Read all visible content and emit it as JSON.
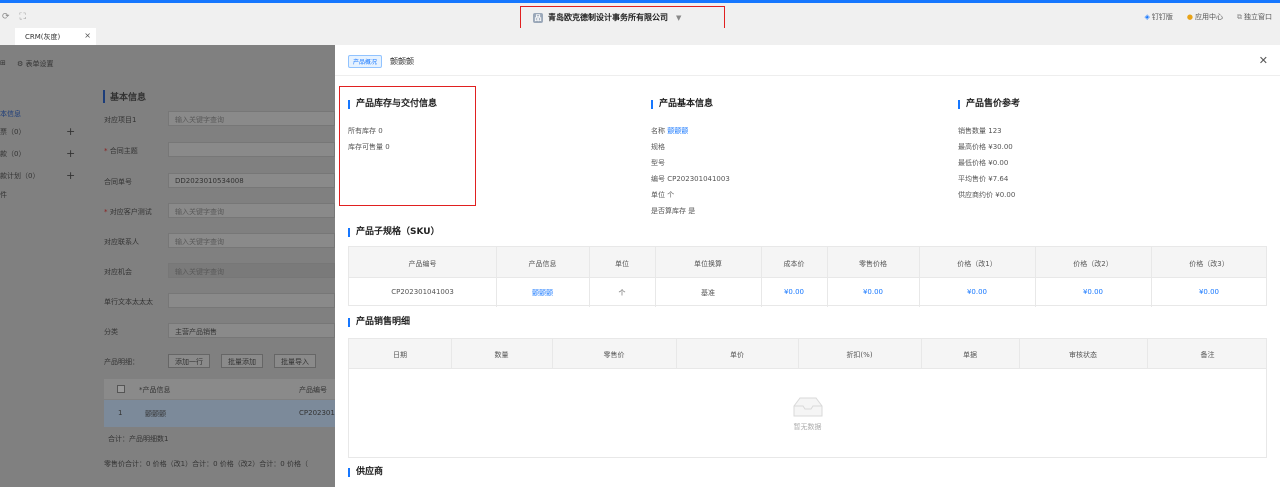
{
  "topbar": {
    "company": "青岛欧克德制设计事务所有限公司",
    "links": [
      "钉钉版",
      "应用中心",
      "独立窗口"
    ]
  },
  "tab": {
    "label": "CRM(灰度)",
    "close": "×"
  },
  "bg": {
    "toolbar_label": "表单设置",
    "side": [
      "本信息",
      "票（0）",
      "款（0）",
      "款计划（0）",
      "件"
    ],
    "section": "基本信息",
    "form_labels": [
      "对应项目1",
      "合同主题",
      "合同单号",
      "对应客户测试",
      "对应联系人",
      "对应机会",
      "单行文本太太太",
      "分类",
      "产品明细："
    ],
    "placeholder": "输入关键字查询",
    "contract_no": "DD2023010534008",
    "category": "主营产品销售",
    "btns": [
      "添加一行",
      "批量添加",
      "批量导入"
    ],
    "th": [
      "*产品信息",
      "产品编号"
    ],
    "row": {
      "idx": "1",
      "name": "颤颤颤",
      "code": "CP2023010"
    },
    "total": "合计：产品明细数1",
    "footer": "零售价合计：0 价格（改1）合计：0 价格（改2）合计：0 价格（"
  },
  "panel": {
    "badge": "产品概况",
    "title": "颤颤颤",
    "stock": {
      "title": "产品库存与交付信息",
      "items": [
        {
          "k": "所有库存",
          "v": "0"
        },
        {
          "k": "库存可售量",
          "v": "0"
        }
      ]
    },
    "basic": {
      "title": "产品基本信息",
      "items": [
        {
          "k": "名称",
          "v": "颤颤颤"
        },
        {
          "k": "规格",
          "v": ""
        },
        {
          "k": "型号",
          "v": ""
        },
        {
          "k": "编号",
          "v": "CP202301041003"
        },
        {
          "k": "单位",
          "v": "个"
        },
        {
          "k": "是否算库存",
          "v": "是"
        }
      ]
    },
    "price": {
      "title": "产品售价参考",
      "items": [
        {
          "k": "销售数量",
          "v": "123"
        },
        {
          "k": "最高价格",
          "v": "¥30.00"
        },
        {
          "k": "最低价格",
          "v": "¥0.00"
        },
        {
          "k": "平均售价",
          "v": "¥7.64"
        },
        {
          "k": "供应商约价",
          "v": "¥0.00"
        }
      ]
    },
    "sku": {
      "title": "产品子规格（SKU）",
      "headers": [
        "产品编号",
        "产品信息",
        "单位",
        "单位换算",
        "成本价",
        "零售价格",
        "价格（改1）",
        "价格（改2）",
        "价格（改3）"
      ],
      "row": [
        "CP202301041003",
        "颤颤颤",
        "个",
        "基准",
        "¥0.00",
        "¥0.00",
        "¥0.00",
        "¥0.00",
        "¥0.00"
      ]
    },
    "sales": {
      "title": "产品销售明细",
      "headers": [
        "日期",
        "数量",
        "零售价",
        "单价",
        "折扣(%)",
        "单据",
        "审核状态",
        "备注"
      ],
      "empty": "暂无数据"
    },
    "supplier": {
      "title": "供应商"
    }
  }
}
